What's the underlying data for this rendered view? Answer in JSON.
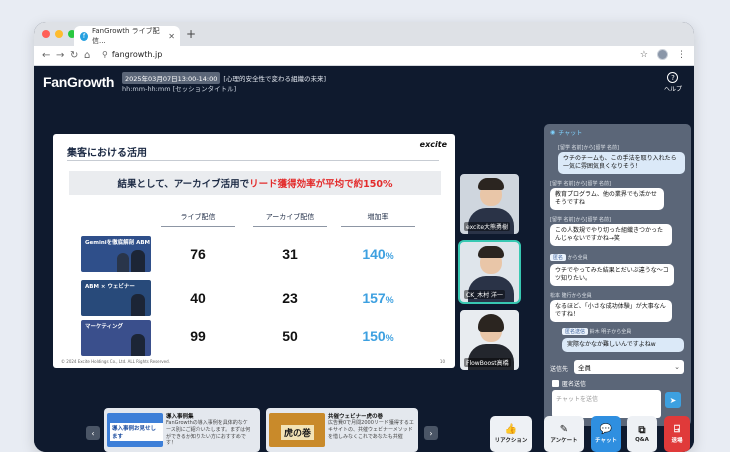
{
  "browser": {
    "tab_title": "FanGrowth ライブ配信...",
    "url": "fangrowth.jp",
    "dot_colors": [
      "#ff5f57",
      "#febc2e",
      "#28c840"
    ]
  },
  "header": {
    "logo": "FanGrowth",
    "datetime": "2025年03月07日13:00-14:00",
    "event_title": "[心理的安全性で変わる組織の未来]",
    "session": "hh:mm-hh:mm [セッションタイトル]",
    "help_label": "ヘルプ"
  },
  "slide": {
    "title": "集客における活用",
    "brand": "excite",
    "headline_prefix": "結果として、アーカイブ活用で",
    "headline_red": "リード獲得効率が平均で約150%",
    "columns": [
      "ライブ配信",
      "アーカイブ配信",
      "増加率"
    ],
    "rows": [
      {
        "thumb_text": "Geminiを徹底解剖 ABM",
        "live": "76",
        "archive": "31",
        "rate": "140",
        "pct": "%",
        "thumb_color": "#2f4f8a"
      },
      {
        "thumb_text": "ABM × ウェビナー",
        "live": "40",
        "archive": "23",
        "rate": "157",
        "pct": "%",
        "thumb_color": "#284a7a"
      },
      {
        "thumb_text": "マーケティング",
        "live": "99",
        "archive": "50",
        "rate": "150",
        "pct": "%",
        "thumb_color": "#3a4f8c"
      }
    ],
    "footer": "© 2024 Excite Holdings Co., Ltd. ALL Rights Reserved.",
    "page": "10"
  },
  "speakers": [
    {
      "name": "excite大熊勇樹",
      "active": false
    },
    {
      "name": "CK_木村 洋一",
      "active": true
    },
    {
      "name": "FlowBoost高橋",
      "active": false
    }
  ],
  "chat": {
    "title": "チャット",
    "messages": [
      {
        "meta": "[留学 名前]から[留学 名前]",
        "text": "ウチのチームも、この手法を取り入れたら一気に雰囲気良くなりそう！",
        "me": true
      },
      {
        "meta": "[留学 名前]から[留学 名前]",
        "text": "教育プログラム、他の業界でも活かせそうですね",
        "me": false
      },
      {
        "meta": "[留学 名前]から[留学 名前]",
        "text": "この人数規でやり切った組織きつかったんじゃないですかね→笑",
        "me": false
      },
      {
        "meta": "から全員",
        "anon": "匿名",
        "text": "ウチでやってみた結果とだいぶ違うな～コツ知りたい。",
        "me": false
      },
      {
        "meta": "松本 隆行から全員",
        "text": "なるほど、「小さな成功体験」が大事なんですね！",
        "me": false
      },
      {
        "meta": "鈴木 明子から全員",
        "anon": "匿名送信",
        "text": "実際なかなか難しいんですよねw",
        "me": true
      }
    ],
    "dest_label": "送信先",
    "dest_value": "全員",
    "anon_label": "匿名送信",
    "input_placeholder": "チャットを送信"
  },
  "cards": [
    {
      "title": "導入事例集",
      "thumb_text": "導入事例お見せします",
      "desc": "FanGrowthの導入事例を具体的なケース別にご紹介いたします。まずは何ができるか知りたい方におすすめです！",
      "thumb_color": "#3d7fd8"
    },
    {
      "title": "共催ウェビナー虎の巻",
      "thumb_text": "虎の巻",
      "desc": "広告費0で月間2000リード獲得するエキサイトの、共催ウェビナーメソッドを惜しみなくこれであなたも共催",
      "thumb_color": "#c98a2a"
    }
  ],
  "actions": [
    {
      "label": "リアクション",
      "icon": "👍",
      "bg": "#eef1f5",
      "fg": "#222"
    },
    {
      "label": "アンケート",
      "icon": "✎",
      "bg": "#eef1f5",
      "fg": "#222"
    },
    {
      "label": "チャット",
      "icon": "💬",
      "bg": "#2f8fe0",
      "fg": "#fff"
    },
    {
      "label": "Q&A",
      "icon": "⧉",
      "bg": "#eef1f5",
      "fg": "#222"
    },
    {
      "label": "退場",
      "icon": "⍈",
      "bg": "#e03a3a",
      "fg": "#fff"
    }
  ]
}
